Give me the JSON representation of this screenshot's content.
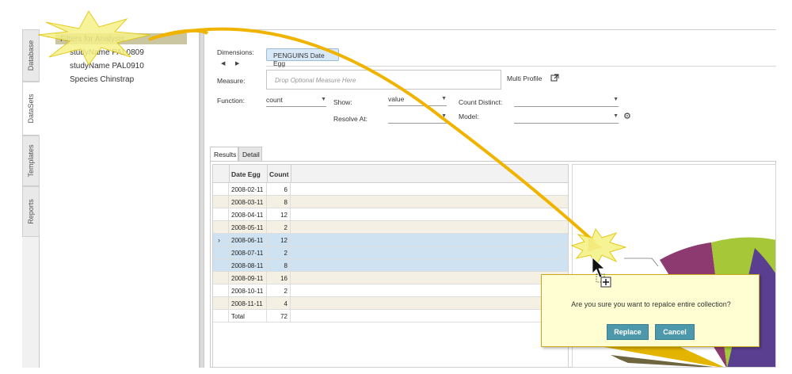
{
  "sidebar": {
    "tabs": [
      {
        "label": "Database"
      },
      {
        "label": "DataSets"
      },
      {
        "label": "Templates"
      },
      {
        "label": "Reports"
      }
    ]
  },
  "filters": {
    "toggle": "-",
    "title": "Filters for Analysis",
    "items": [
      "studyName PAL0809",
      "studyName PAL0910",
      "Species Chinstrap"
    ]
  },
  "form": {
    "dimensions_label": "Dimensions:",
    "dimension_chip": "PENGUINS Date Egg",
    "measure_label": "Measure:",
    "measure_placeholder": "Drop Optional Measure Here",
    "multi_profile_label": "Multi Profile",
    "function_label": "Function:",
    "function_value": "count",
    "show_label": "Show:",
    "show_value": "value",
    "count_distinct_label": "Count Distinct:",
    "count_distinct_value": "",
    "resolve_at_label": "Resolve At:",
    "resolve_at_value": "",
    "model_label": "Model:",
    "model_value": ""
  },
  "results": {
    "tabs": [
      "Results",
      "Detail"
    ],
    "columns": [
      "Date Egg",
      "Count"
    ],
    "rows": [
      {
        "date": "2008-02-11",
        "count": "6",
        "style": "white"
      },
      {
        "date": "2008-03-11",
        "count": "8",
        "style": "alt"
      },
      {
        "date": "2008-04-11",
        "count": "12",
        "style": "white"
      },
      {
        "date": "2008-05-11",
        "count": "2",
        "style": "alt"
      },
      {
        "date": "2008-06-11",
        "count": "12",
        "style": "selected",
        "indicator": "›"
      },
      {
        "date": "2008-07-11",
        "count": "2",
        "style": "selected"
      },
      {
        "date": "2008-08-11",
        "count": "8",
        "style": "selected"
      },
      {
        "date": "2008-09-11",
        "count": "16",
        "style": "alt"
      },
      {
        "date": "2008-10-11",
        "count": "2",
        "style": "white"
      },
      {
        "date": "2008-11-11",
        "count": "4",
        "style": "alt"
      },
      {
        "date": "Total",
        "count": "72",
        "style": "white"
      }
    ]
  },
  "dialog": {
    "message": "Are you sure you want to repalce entire collection?",
    "replace_label": "Replace",
    "cancel_label": "Cancel"
  },
  "colors": {
    "accent_button": "#4e98ac",
    "selection_row": "#cfe2f1",
    "alt_row": "#f5f0e4",
    "dialog_bg": "#fefed2",
    "arrow": "#f0b400"
  },
  "icons": {
    "external_link": "external-link-icon",
    "settings": "gear-icon",
    "cursor": "mouse-pointer-icon",
    "drag_copy": "drag-add-icon"
  }
}
